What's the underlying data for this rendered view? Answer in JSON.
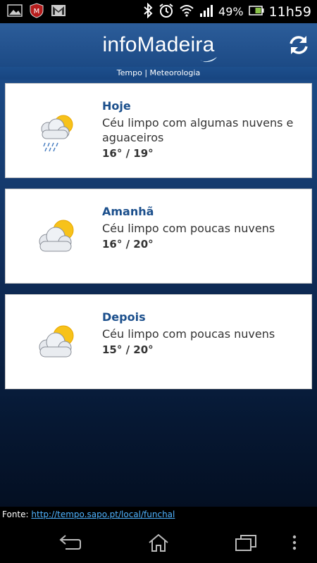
{
  "status_bar": {
    "battery_percent": "49%",
    "time": "11h59",
    "icons": [
      "gallery-icon",
      "mcafee-icon",
      "gmail-icon",
      "bluetooth-icon",
      "alarm-icon",
      "wifi-icon",
      "signal-icon",
      "battery-icon"
    ]
  },
  "app": {
    "logo_text": "infoMadeira",
    "subtitle": "Tempo | Meteorologia"
  },
  "forecast": [
    {
      "day": "Hoje",
      "description": "Céu limpo com algumas nuvens e aguaceiros",
      "temperature": "16° / 19°",
      "icon": "partly-cloudy-rain-icon"
    },
    {
      "day": "Amanhã",
      "description": "Céu limpo com poucas nuvens",
      "temperature": "16° / 20°",
      "icon": "partly-cloudy-icon"
    },
    {
      "day": "Depois",
      "description": "Céu limpo com poucas nuvens",
      "temperature": "15° / 20°",
      "icon": "partly-cloudy-icon"
    }
  ],
  "source": {
    "label": "Fonte:",
    "link": "http://tempo.sapo.pt/local/funchal"
  },
  "colors": {
    "header": "#2c5d9a",
    "title_blue": "#1b4f8c",
    "link": "#4fb3ff"
  }
}
